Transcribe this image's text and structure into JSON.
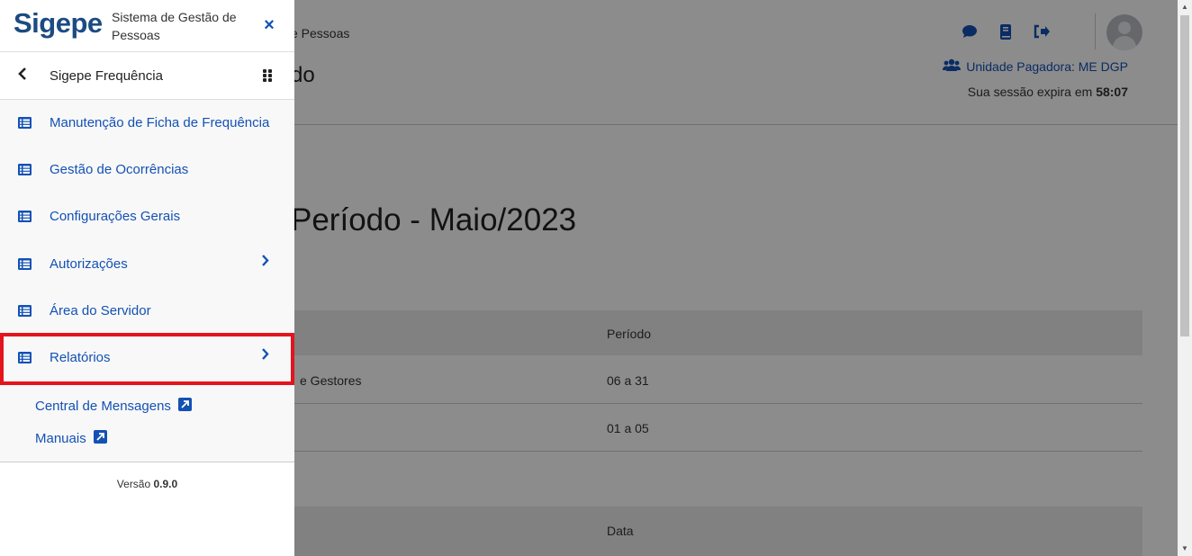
{
  "header": {
    "breadcrumb_fragment": "e Pessoas",
    "subtitle_fragment": "do",
    "unit_label": "Unidade Pagadora: ME DGP",
    "session_prefix": "Sua sessão expira em",
    "session_time": "58:07",
    "icons": [
      "chat-icon",
      "book-icon",
      "logout-icon",
      "users-icon"
    ]
  },
  "main": {
    "title_fragment": "Período - Maio/2023",
    "table1": {
      "header_col2": "Período",
      "rows": [
        {
          "col1_fragment": "e Gestores",
          "col2": "06 a 31"
        },
        {
          "col1_fragment": "",
          "col2": "01 a 05"
        }
      ]
    },
    "table2": {
      "header_col2": "Data"
    }
  },
  "drawer": {
    "logo": "Sigepe",
    "logo_subtitle": "Sistema de Gestão de Pessoas",
    "close_glyph": "×",
    "module_title": "Sigepe Frequência",
    "items": [
      {
        "label": "Manutenção de Ficha de Frequência",
        "has_submenu": false
      },
      {
        "label": "Gestão de Ocorrências",
        "has_submenu": false
      },
      {
        "label": "Configurações Gerais",
        "has_submenu": false
      },
      {
        "label": "Autorizações",
        "has_submenu": true
      },
      {
        "label": "Área do Servidor",
        "has_submenu": false
      },
      {
        "label": "Relatórios",
        "has_submenu": true
      }
    ],
    "links": [
      {
        "label": "Central de Mensagens"
      },
      {
        "label": "Manuais"
      }
    ],
    "version_prefix": "Versão",
    "version": "0.9.0"
  },
  "colors": {
    "primary": "#1351b4",
    "logo": "#1b4b82",
    "highlight": "#e3141e"
  }
}
